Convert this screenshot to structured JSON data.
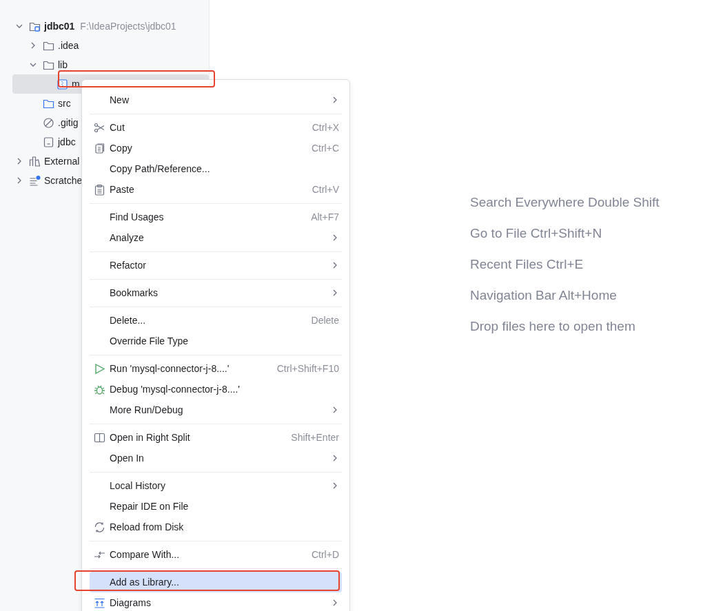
{
  "project_tree": [
    {
      "label": "jdbc01",
      "detail": "F:\\IdeaProjects\\jdbc01",
      "kind": "project",
      "expanded": true,
      "children": [
        {
          "label": ".idea",
          "kind": "folder",
          "expanded": false
        },
        {
          "label": "lib",
          "kind": "folder",
          "expanded": true,
          "children": [
            {
              "label": "m",
              "kind": "archive",
              "selected": true,
              "highlighted": true
            }
          ]
        },
        {
          "label": "src",
          "kind": "source"
        },
        {
          "label": ".gitig",
          "kind": "ignore"
        },
        {
          "label": "jdbc",
          "kind": "file"
        }
      ]
    },
    {
      "label": "External",
      "kind": "libraries",
      "expanded": false
    },
    {
      "label": "Scratche",
      "kind": "scratches",
      "expanded": false
    }
  ],
  "context_menu": [
    {
      "kind": "item",
      "label": "New",
      "submenu": true,
      "selected": false
    },
    {
      "kind": "separator"
    },
    {
      "kind": "cut",
      "label": "Cut",
      "shortcut": "Ctrl+X",
      "selected": false
    },
    {
      "kind": "copy",
      "label": "Copy",
      "shortcut": "Ctrl+C",
      "selected": false
    },
    {
      "kind": "item",
      "label": "Copy Path/Reference...",
      "selected": false
    },
    {
      "kind": "paste",
      "label": "Paste",
      "shortcut": "Ctrl+V",
      "selected": false
    },
    {
      "kind": "separator"
    },
    {
      "kind": "item",
      "label": "Find Usages",
      "shortcut": "Alt+F7",
      "selected": false
    },
    {
      "kind": "item",
      "label": "Analyze",
      "submenu": true,
      "selected": false
    },
    {
      "kind": "separator"
    },
    {
      "kind": "item",
      "label": "Refactor",
      "submenu": true,
      "selected": false
    },
    {
      "kind": "separator"
    },
    {
      "kind": "item",
      "label": "Bookmarks",
      "submenu": true,
      "selected": false
    },
    {
      "kind": "separator"
    },
    {
      "kind": "item",
      "label": "Delete...",
      "shortcut": "Delete",
      "selected": false
    },
    {
      "kind": "item",
      "label": "Override File Type",
      "selected": false
    },
    {
      "kind": "separator"
    },
    {
      "kind": "run",
      "label": "Run 'mysql-connector-j-8....'",
      "shortcut": "Ctrl+Shift+F10",
      "selected": false
    },
    {
      "kind": "debug",
      "label": "Debug 'mysql-connector-j-8....'",
      "selected": false
    },
    {
      "kind": "item",
      "label": "More Run/Debug",
      "submenu": true,
      "selected": false
    },
    {
      "kind": "separator"
    },
    {
      "kind": "split",
      "label": "Open in Right Split",
      "shortcut": "Shift+Enter",
      "selected": false
    },
    {
      "kind": "item",
      "label": "Open In",
      "submenu": true,
      "selected": false
    },
    {
      "kind": "separator"
    },
    {
      "kind": "item",
      "label": "Local History",
      "submenu": true,
      "selected": false
    },
    {
      "kind": "item",
      "label": "Repair IDE on File",
      "selected": false
    },
    {
      "kind": "reload",
      "label": "Reload from Disk",
      "selected": false
    },
    {
      "kind": "separator"
    },
    {
      "kind": "compare",
      "label": "Compare With...",
      "shortcut": "Ctrl+D",
      "selected": false
    },
    {
      "kind": "separator"
    },
    {
      "kind": "item",
      "label": "Add as Library...",
      "selected": true,
      "highlighted": true
    },
    {
      "kind": "diagrams",
      "label": "Diagrams",
      "submenu": true,
      "selected": false
    }
  ],
  "editor_hints": [
    "Search Everywhere Double Shift",
    "Go to File Ctrl+Shift+N",
    "Recent Files Ctrl+E",
    "Navigation Bar Alt+Home",
    "Drop files here to open them"
  ]
}
